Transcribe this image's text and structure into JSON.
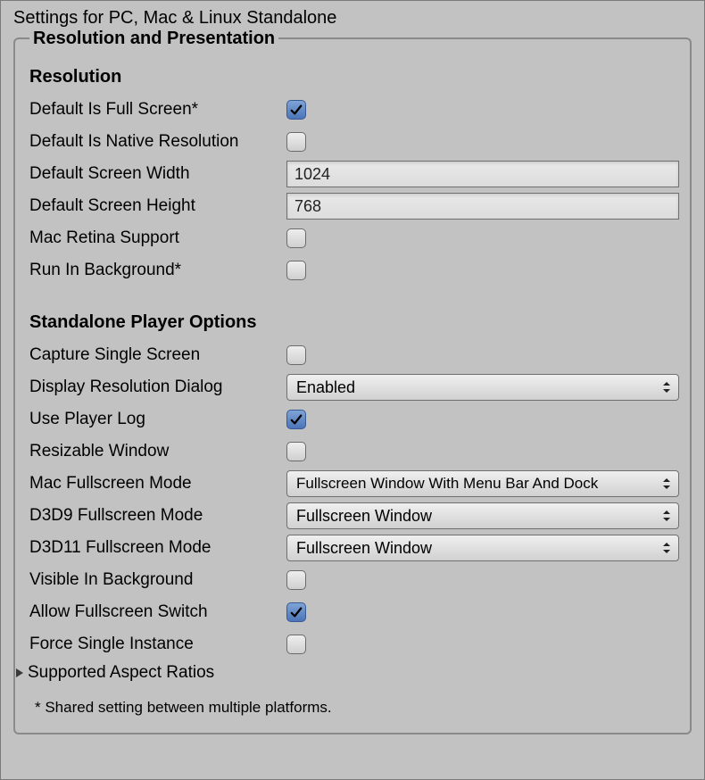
{
  "page_title": "Settings for PC, Mac & Linux Standalone",
  "section_title": "Resolution and Presentation",
  "resolution_heading": "Resolution",
  "player_options_heading": "Standalone Player Options",
  "footnote": "* Shared setting between multiple platforms.",
  "supported_aspect_ratios_label": "Supported Aspect Ratios",
  "rows": {
    "default_full_screen": {
      "label": "Default Is Full Screen*",
      "checked": true
    },
    "default_native_res": {
      "label": "Default Is Native Resolution",
      "checked": false
    },
    "default_screen_width": {
      "label": "Default Screen Width",
      "value": "1024"
    },
    "default_screen_height": {
      "label": "Default Screen Height",
      "value": "768"
    },
    "mac_retina": {
      "label": "Mac Retina Support",
      "checked": false
    },
    "run_in_background": {
      "label": "Run In Background*",
      "checked": false
    },
    "capture_single_screen": {
      "label": "Capture Single Screen",
      "checked": false
    },
    "display_res_dialog": {
      "label": "Display Resolution Dialog",
      "value": "Enabled"
    },
    "use_player_log": {
      "label": "Use Player Log",
      "checked": true
    },
    "resizable_window": {
      "label": "Resizable Window",
      "checked": false
    },
    "mac_fullscreen_mode": {
      "label": "Mac Fullscreen Mode",
      "value": "Fullscreen Window With Menu Bar And Dock"
    },
    "d3d9_fullscreen_mode": {
      "label": "D3D9 Fullscreen Mode",
      "value": "Fullscreen Window"
    },
    "d3d11_fullscreen_mode": {
      "label": "D3D11 Fullscreen Mode",
      "value": "Fullscreen Window"
    },
    "visible_in_background": {
      "label": "Visible In Background",
      "checked": false
    },
    "allow_fullscreen_switch": {
      "label": "Allow Fullscreen Switch",
      "checked": true
    },
    "force_single_instance": {
      "label": "Force Single Instance",
      "checked": false
    }
  }
}
